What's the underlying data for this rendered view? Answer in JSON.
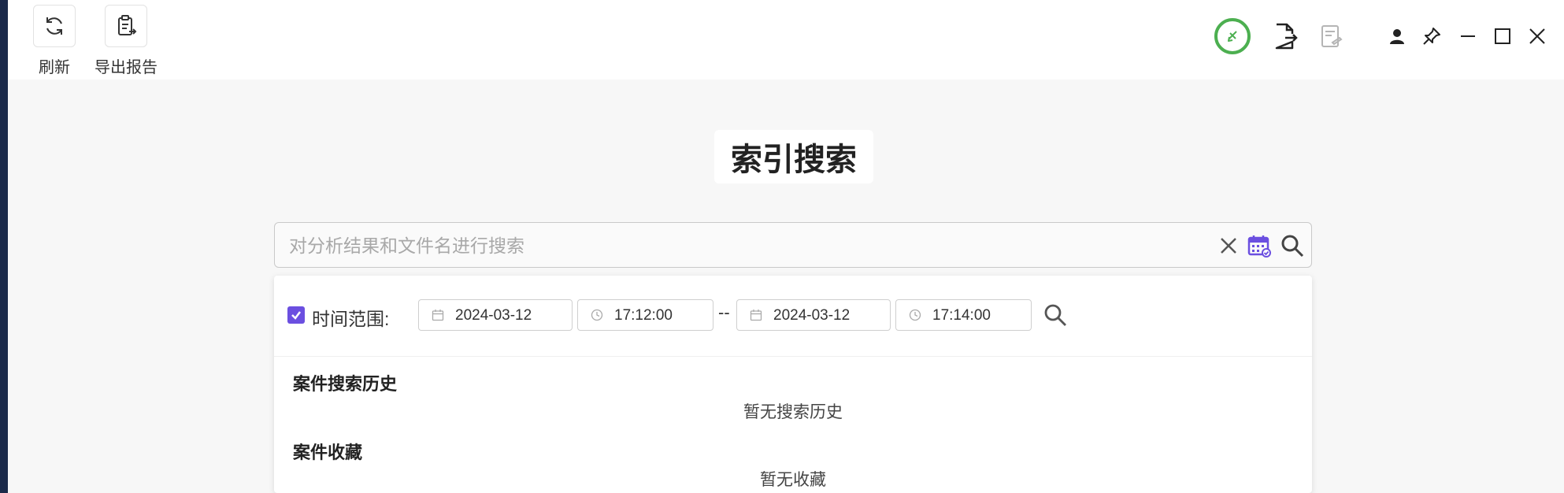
{
  "toolbar": {
    "refresh_label": "刷新",
    "export_label": "导出报告"
  },
  "page": {
    "title": "索引搜索"
  },
  "search": {
    "placeholder": "对分析结果和文件名进行搜索",
    "value": ""
  },
  "time_filter": {
    "checked": true,
    "label": "时间范围:",
    "start_date": "2024-03-12",
    "start_time": "17:12:00",
    "separator": "--",
    "end_date": "2024-03-12",
    "end_time": "17:14:00"
  },
  "history": {
    "title": "案件搜索历史",
    "empty_text": "暂无搜索历史"
  },
  "favorites": {
    "title": "案件收藏",
    "empty_text": "暂无收藏"
  },
  "icons": {
    "refresh": "refresh-icon",
    "export": "clipboard-export-icon",
    "status": "green-bell-icon",
    "file_export": "file-export-icon",
    "report": "report-icon",
    "user": "user-icon",
    "pin": "pin-icon",
    "minimize": "minimize-icon",
    "maximize": "maximize-icon",
    "close": "close-icon",
    "clear": "clear-icon",
    "calendar": "calendar-icon",
    "search": "search-icon",
    "clock": "clock-icon"
  },
  "colors": {
    "accent": "#6b4fe0",
    "status_green": "#4caf50",
    "window_edge": "#1b2a4a"
  }
}
